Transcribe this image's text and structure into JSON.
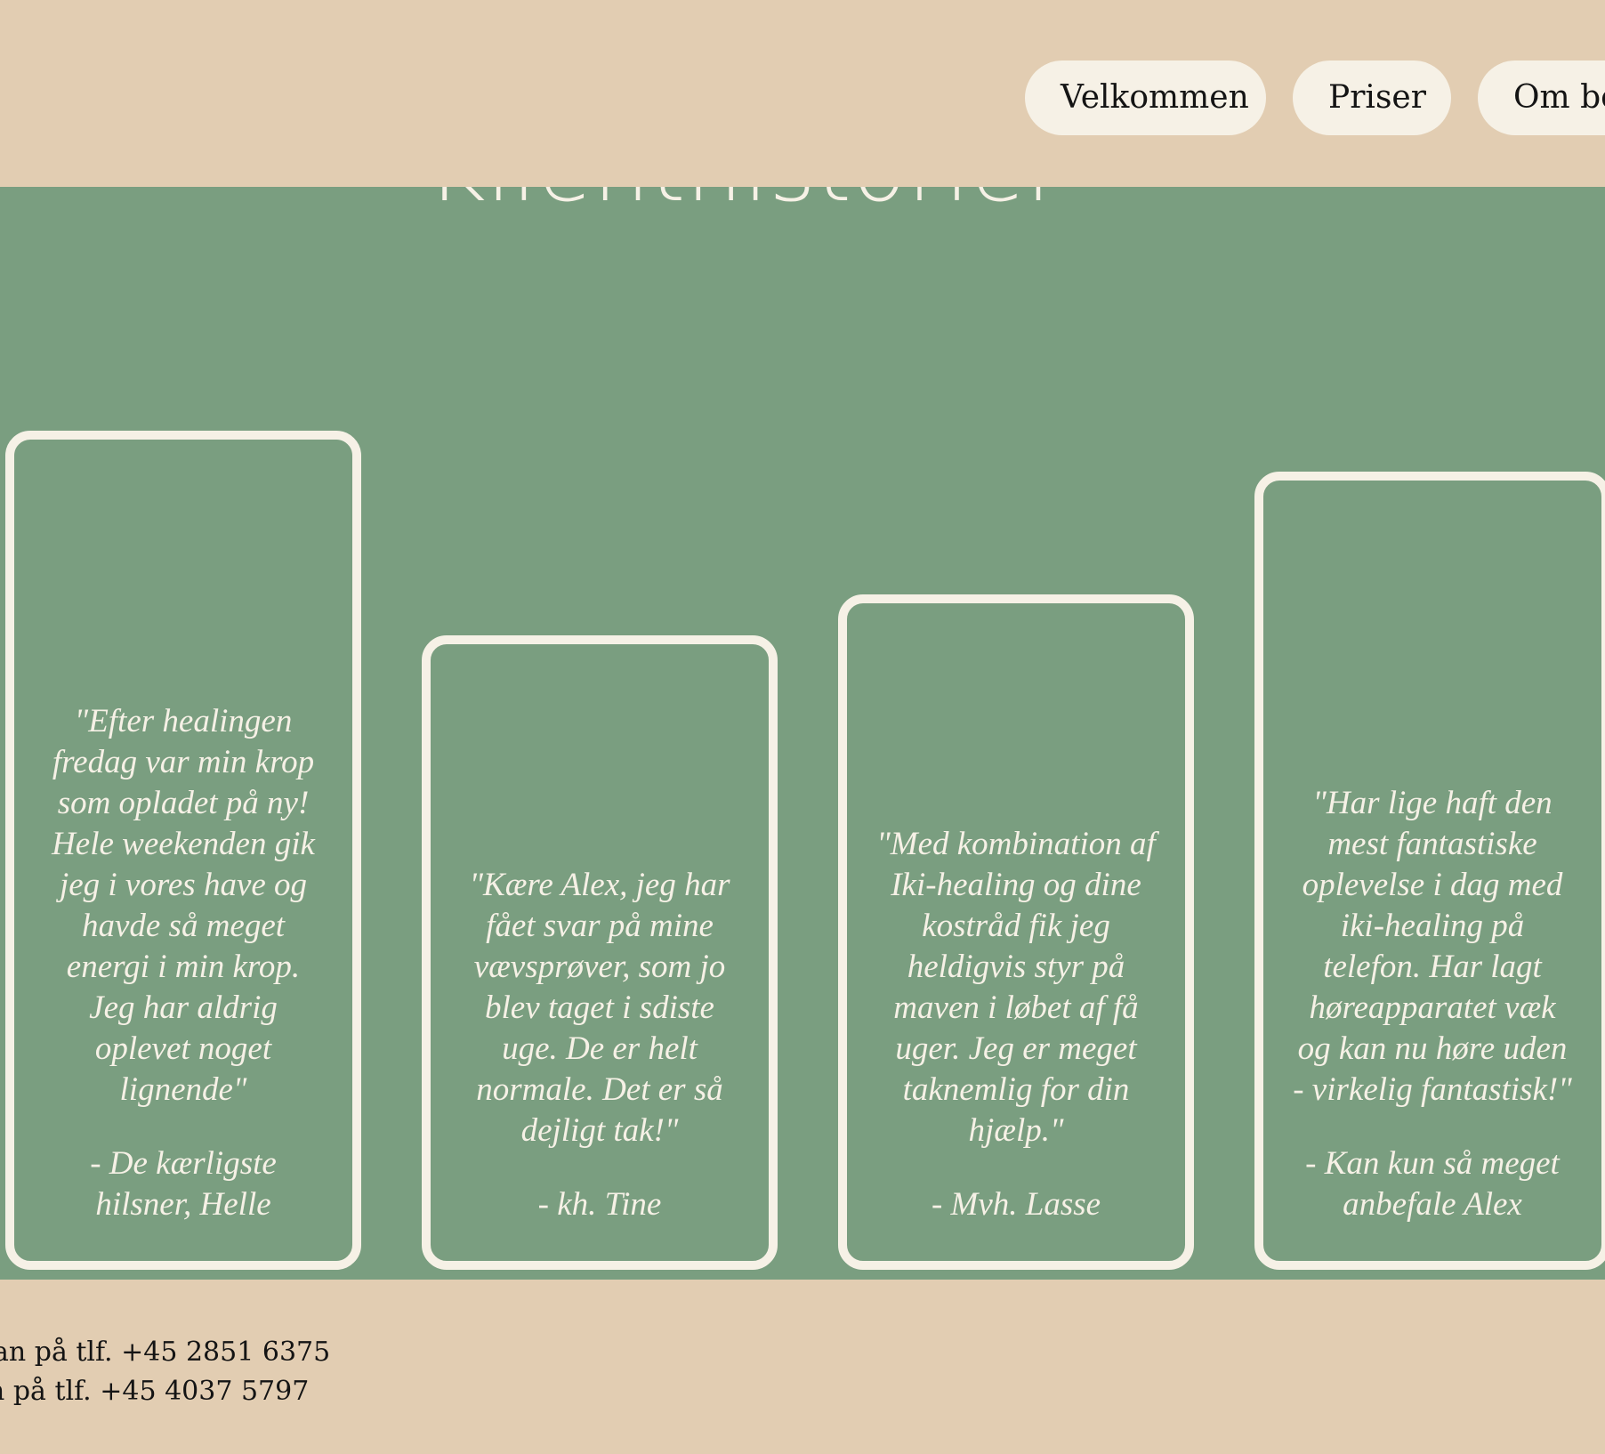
{
  "header": {
    "nav": [
      {
        "label": "Velkommen"
      },
      {
        "label": "Priser"
      },
      {
        "label": "Om be"
      }
    ]
  },
  "section": {
    "title": "Klienthistorier"
  },
  "testimonials": [
    {
      "quote": "\"Efter healingen fredag var min krop som opladet på ny! Hele weekenden gik jeg i vores have og havde så meget energi i min krop. Jeg har aldrig oplevet noget lignende\"",
      "signature": "- De kærligste hilsner, Helle"
    },
    {
      "quote": "\"Kære Alex, jeg har fået svar på mine vævsprøver, som jo blev taget i sdiste uge. De er helt normale. Det er så dejligt tak!\"",
      "signature": "- kh. Tine"
    },
    {
      "quote": "\"Med kombination af Iki-healing og dine kostråd fik jeg heldigvis styr på maven i løbet af få uger. Jeg er meget taknemlig for din hjælp.\"",
      "signature": "- Mvh. Lasse"
    },
    {
      "quote": "\"Har lige haft den mest fantastiske oplevelse i dag med iki-healing på telefon. Har lagt høreapparatet væk og kan nu høre uden - virkelig fantastisk!\"",
      "signature": "- Kan kun så meget anbefale Alex"
    }
  ],
  "footer": {
    "lines": [
      "an på tlf. +45 2851 6375",
      "n på tlf. +45 4037 5797"
    ]
  },
  "colors": {
    "header_bg": "#e2cdb2",
    "section_bg": "#7a9e80",
    "card_border": "#f6f1e6",
    "nav_button_bg": "#f6f1e6",
    "text_dark": "#141414"
  }
}
